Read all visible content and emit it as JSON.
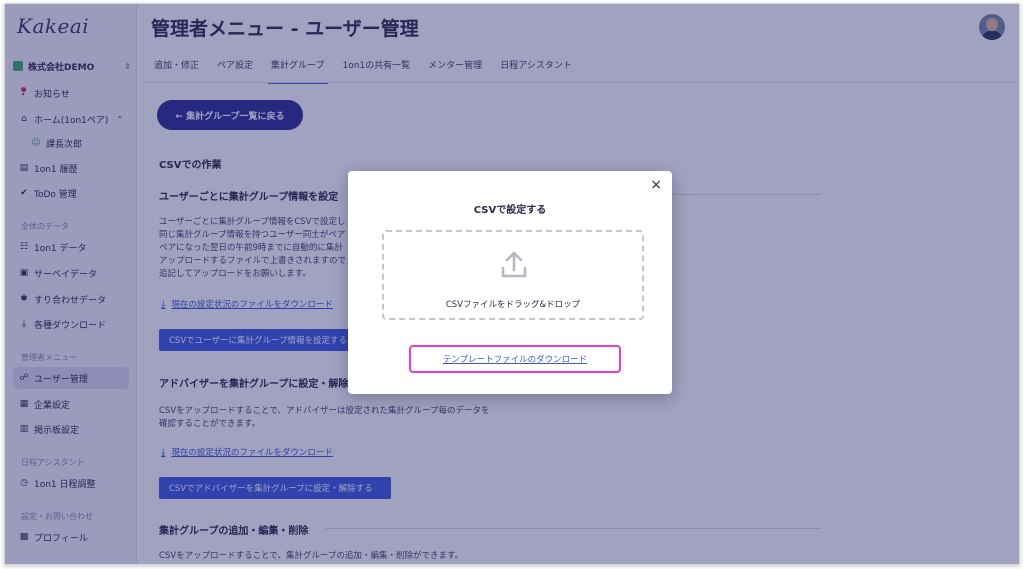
{
  "app": {
    "logo": "Kakeai",
    "title": "管理者メニュー - ユーザー管理"
  },
  "sidebar": {
    "company": "株式会社DEMO",
    "items": [
      {
        "label": "お知らせ",
        "icon": "bell-icon"
      },
      {
        "label": "ホーム(1on1ペア)",
        "icon": "home-icon"
      },
      {
        "label": "課長次郎",
        "icon": "user-icon"
      },
      {
        "label": "1on1 履歴",
        "icon": "history-icon"
      },
      {
        "label": "ToDo 管理",
        "icon": "check-icon"
      }
    ],
    "section_data": "全体のデータ",
    "data_items": [
      {
        "label": "1on1 データ",
        "icon": "people-icon"
      },
      {
        "label": "サーベイデータ",
        "icon": "calendar-icon"
      },
      {
        "label": "すり合わせデータ",
        "icon": "puzzle-icon"
      },
      {
        "label": "各種ダウンロード",
        "icon": "download-icon"
      }
    ],
    "section_admin": "管理者メニュー",
    "admin_items": [
      {
        "label": "ユーザー管理",
        "icon": "users-icon"
      },
      {
        "label": "企業設定",
        "icon": "building-icon"
      },
      {
        "label": "掲示板設定",
        "icon": "board-icon"
      }
    ],
    "section_schedule": "日程アシスタント",
    "schedule_items": [
      {
        "label": "1on1 日程調整",
        "icon": "clock-icon"
      }
    ],
    "section_settings": "設定・お問い合わせ",
    "settings_items": [
      {
        "label": "プロフィール",
        "icon": "profile-icon"
      }
    ]
  },
  "tabs": [
    "追加・修正",
    "ペア設定",
    "集計グループ",
    "1on1の共有一覧",
    "メンター管理",
    "日程アシスタント"
  ],
  "main": {
    "back_button": "← 集計グループ一覧に戻る",
    "csv_heading": "CSVでの作業",
    "section1_heading": "ユーザーごとに集計グループ情報を設定",
    "section1_lines": [
      "ユーザーごとに集計グループ情報をCSVで設定し",
      "同じ集計グループ情報を持つユーザー同士がペア",
      "ペアになった翌日の午前9時までに自動的に集計",
      "アップロードするファイルで上書きされますので",
      "追記してアップロードをお願いします。"
    ],
    "section1_link": "現在の設定状況のファイルをダウンロード",
    "section1_button": "CSVでユーザーに集計グループ情報を設定する",
    "section2_heading": "アドバイザーを集計グループに設定・解除",
    "section2_lines": [
      "CSVをアップロードすることで、アドバイザーは設定された集計グループ毎のデータを",
      "確認することができます。"
    ],
    "section2_link": "現在の設定状況のファイルをダウンロード",
    "section2_button": "CSVでアドバイザーを集計グループに設定・解除する",
    "section3_heading": "集計グループの追加・編集・削除",
    "section3_line": "CSVをアップロードすることで、集計グループの追加・編集・削除ができます。"
  },
  "modal": {
    "title": "CSVで設定する",
    "drop_text": "CSVファイルをドラッグ&ドロップ",
    "template_link": "テンプレートファイルのダウンロード",
    "close": "×"
  },
  "colors": {
    "overlay": "#1e1e69",
    "highlight": "#e83ec8",
    "primary": "#2e3192",
    "link": "#3b58d9"
  }
}
